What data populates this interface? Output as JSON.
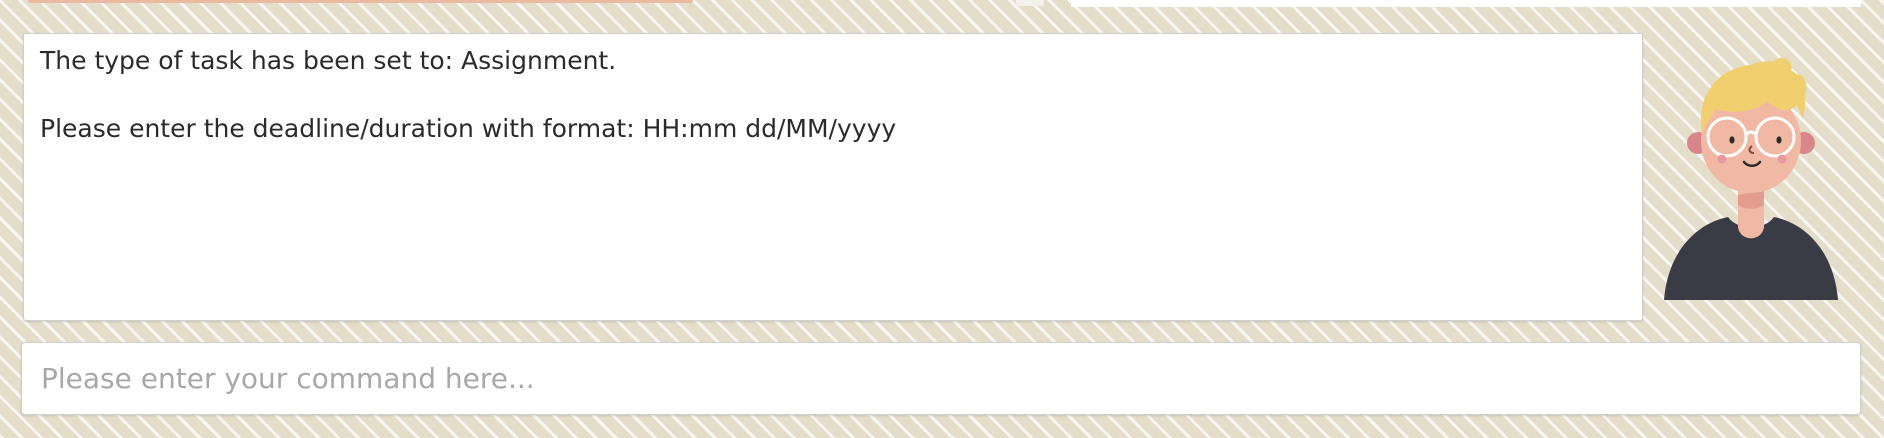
{
  "window": {
    "title": ""
  },
  "output": {
    "lines": [
      "The type of task has been set to: Assignment.",
      "",
      "Please enter the deadline/duration with format: HH:mm dd/MM/yyyy"
    ]
  },
  "command": {
    "value": "",
    "placeholder": "Please enter your command here..."
  },
  "avatar": {
    "icon": "person-avatar-icon",
    "colors": {
      "hair": "#f2cf6e",
      "skin": "#f1b8a4",
      "ear": "#d9868a",
      "shirt": "#393c45",
      "glasses": "#ffffff"
    }
  },
  "theme": {
    "background": "#e4ddca",
    "pattern": "#ffffff",
    "panel": "#ffffff",
    "text": "#2b2b2b",
    "placeholder": "#a8a8a8"
  }
}
